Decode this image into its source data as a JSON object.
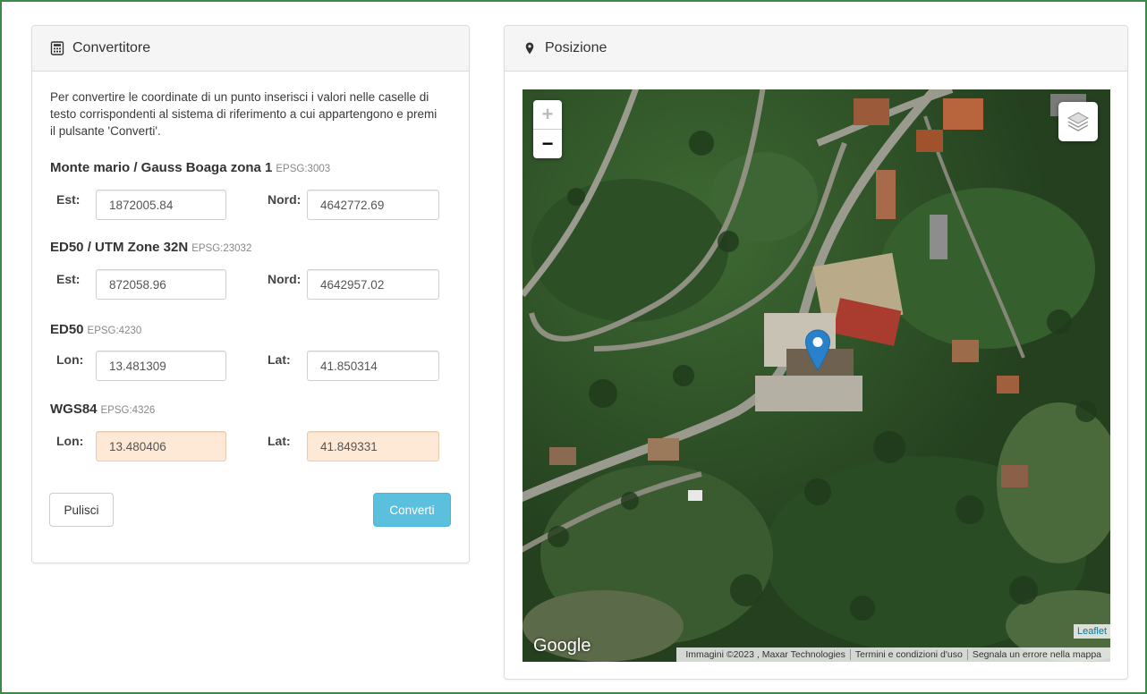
{
  "converter": {
    "title": "Convertitore",
    "intro": "Per convertire le coordinate di un punto inserisci i valori nelle caselle di testo corrispondenti al sistema di riferimento a cui appartengono e premi il pulsante 'Converti'.",
    "sections": [
      {
        "name": "Monte mario / Gauss Boaga zona 1",
        "epsg": "EPSG:3003",
        "label1": "Est:",
        "value1": "1872005.84",
        "label2": "Nord:",
        "value2": "4642772.69"
      },
      {
        "name": "ED50 / UTM Zone 32N",
        "epsg": "EPSG:23032",
        "label1": "Est:",
        "value1": "872058.96",
        "label2": "Nord:",
        "value2": "4642957.02"
      },
      {
        "name": "ED50",
        "epsg": "EPSG:4230",
        "label1": "Lon:",
        "value1": "13.481309",
        "label2": "Lat:",
        "value2": "41.850314"
      },
      {
        "name": "WGS84",
        "epsg": "EPSG:4326",
        "label1": "Lon:",
        "value1": "13.480406",
        "label2": "Lat:",
        "value2": "41.849331"
      }
    ],
    "clear_label": "Pulisci",
    "convert_label": "Converti"
  },
  "position": {
    "title": "Posizione",
    "zoom_in": "+",
    "zoom_out": "−",
    "leaflet": "Leaflet",
    "google": "Google",
    "attribution": [
      "Immagini ©2023 , Maxar Technologies",
      "Termini e condizioni d'uso",
      "Segnala un errore nella mappa"
    ]
  },
  "colors": {
    "frame_border": "#3c8a4a",
    "highlight_input": "#fde9d6",
    "convert_button": "#5bc0de",
    "marker": "#2a81cb"
  }
}
